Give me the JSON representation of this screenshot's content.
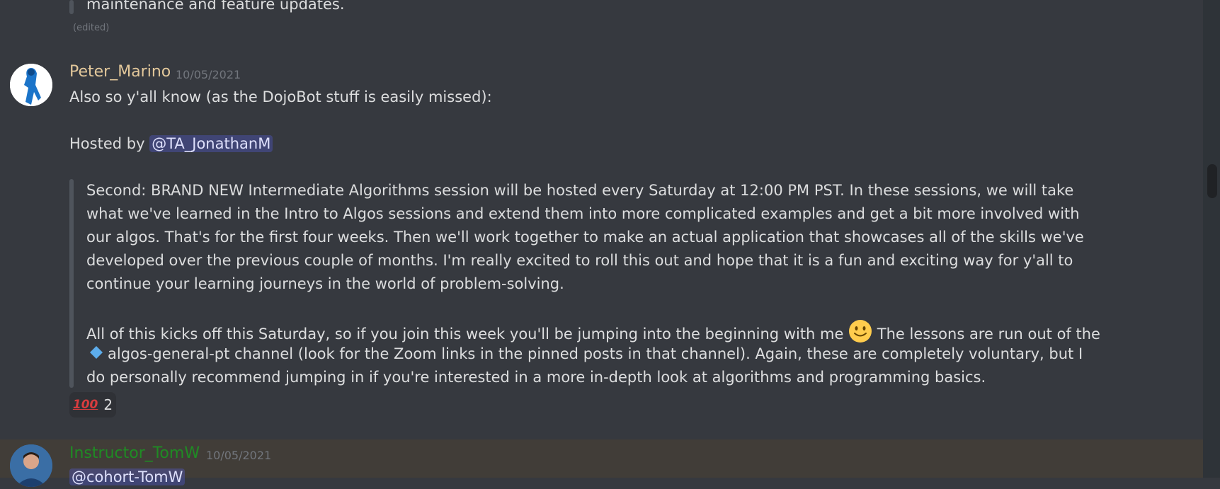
{
  "previous_message": {
    "quote_tail": "maintenance and feature updates.",
    "edited_label": "(edited)"
  },
  "message1": {
    "username": "Peter_Marino",
    "username_color": "#e3c89b",
    "timestamp": "10/05/2021",
    "line1": "Also so y'all know (as the DojoBot stuff is easily missed):",
    "hosted_prefix": "Hosted by",
    "mention": "@TA_JonathanM",
    "quote": {
      "line1": "Second: BRAND NEW Intermediate Algorithms session will be hosted every Saturday at 12:00 PM PST. In these sessions, we will take",
      "line2": "what we've learned in the Intro to Algos sessions and extend them into more complicated examples and get a bit more involved with",
      "line3": "our algos. That's for the first four weeks. Then we'll work together to make an actual application that showcases all of the skills we've",
      "line4": "developed over the previous couple of months. I'm really excited to roll this out and hope that it is a fun and exciting way for y'all to",
      "line5": "continue your learning journeys in the world of problem-solving.",
      "line6a": "All of this kicks off this Saturday, so if you join this week you'll be jumping into the beginning with me",
      "line6b": "The lessons are run out of the",
      "line7": "algos-general-pt channel (look for the Zoom links in the pinned posts in that channel). Again, these are completely voluntary, but I",
      "line8": "do personally recommend jumping in if you're interested in a more in-depth look at algorithms and programming basics."
    },
    "reaction": {
      "emoji": "💯",
      "count": "2"
    }
  },
  "message2": {
    "username": "Instructor_TomW",
    "username_color": "#1f8b24",
    "timestamp": "10/05/2021",
    "mention_partial": "@cohort-TomW"
  },
  "colors": {
    "background": "#36393f",
    "mention_bg": "#4a4f8c",
    "highlight_row": "#413d38"
  }
}
